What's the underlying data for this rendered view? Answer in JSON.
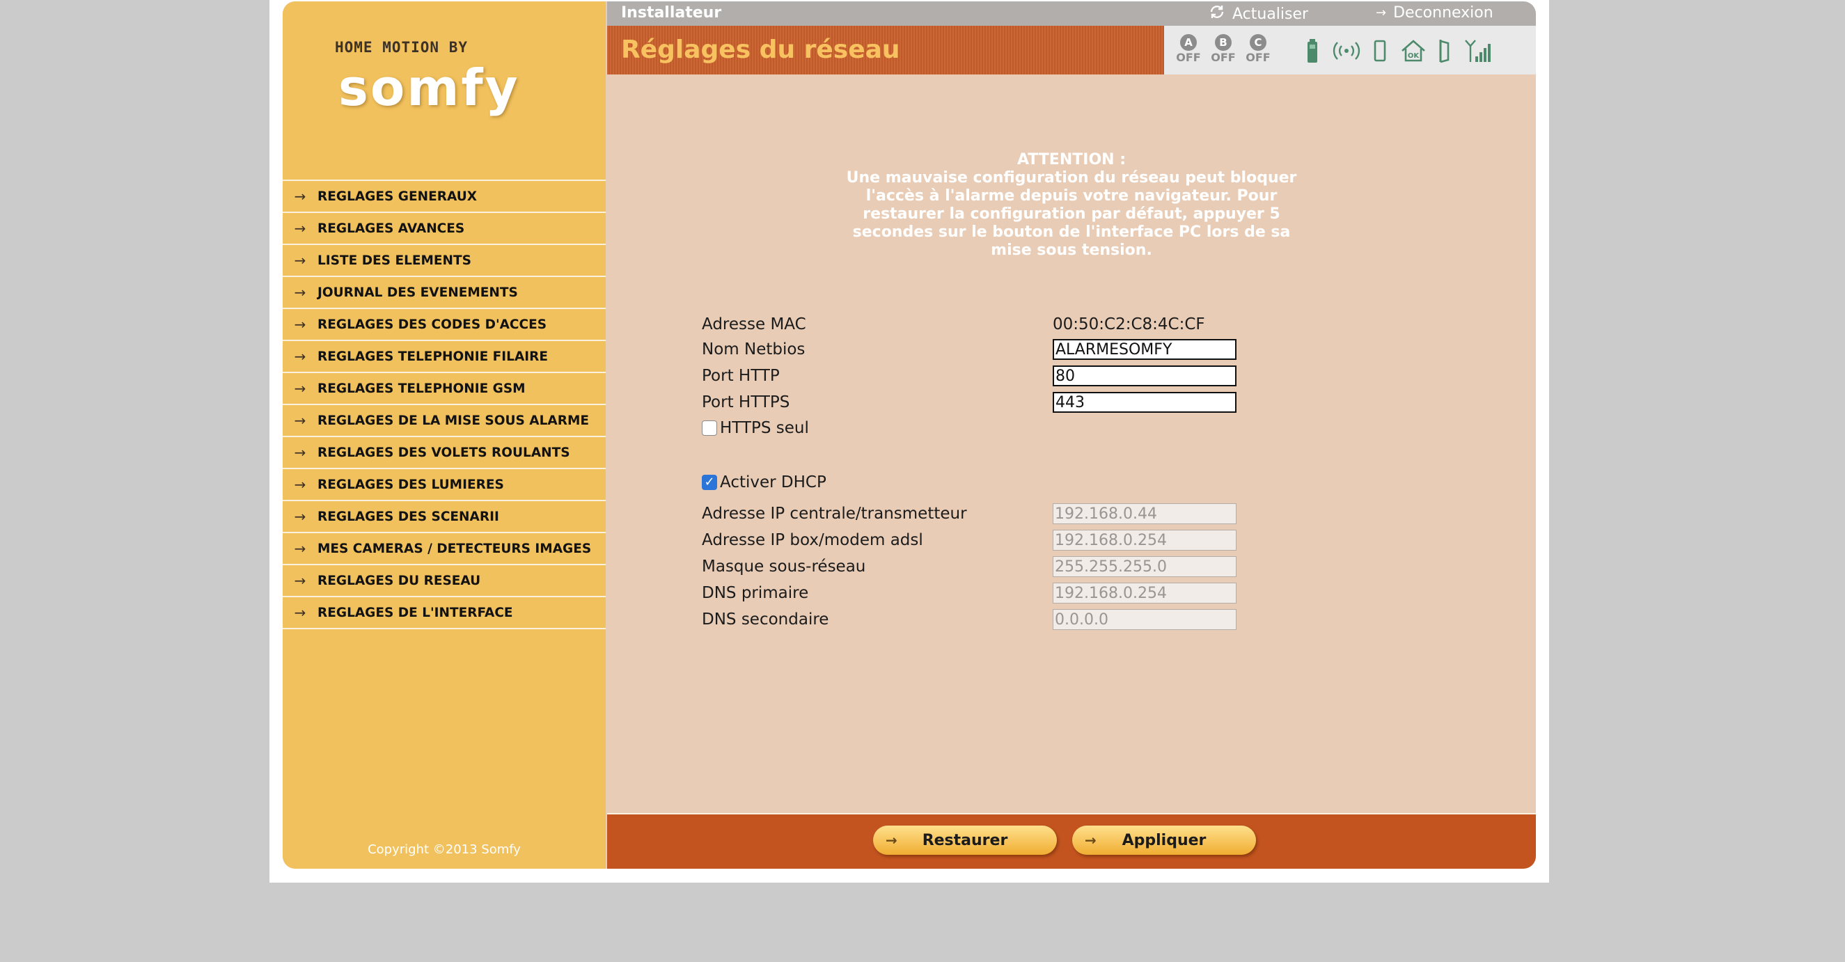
{
  "brand": {
    "tagline": "HOME MOTION BY",
    "name": "somfy"
  },
  "header": {
    "role": "Installateur",
    "refresh_label": "Actualiser",
    "logout_label": "Deconnexion",
    "page_title": "Réglages du réseau"
  },
  "status": {
    "zones": [
      {
        "letter": "A",
        "state": "OFF"
      },
      {
        "letter": "B",
        "state": "OFF"
      },
      {
        "letter": "C",
        "state": "OFF"
      }
    ],
    "icon_color": "#4d8a6c"
  },
  "menu": [
    {
      "label": "REGLAGES GENERAUX"
    },
    {
      "label": "REGLAGES AVANCES"
    },
    {
      "label": "LISTE DES ELEMENTS"
    },
    {
      "label": "JOURNAL DES EVENEMENTS"
    },
    {
      "label": "REGLAGES DES CODES D'ACCES"
    },
    {
      "label": "REGLAGES TELEPHONIE FILAIRE"
    },
    {
      "label": "REGLAGES TELEPHONIE GSM"
    },
    {
      "label": "REGLAGES DE LA MISE SOUS ALARME"
    },
    {
      "label": "REGLAGES DES VOLETS ROULANTS"
    },
    {
      "label": "REGLAGES DES LUMIERES"
    },
    {
      "label": "REGLAGES DES SCENARII"
    },
    {
      "label": "MES CAMERAS / DETECTEURS IMAGES"
    },
    {
      "label": "REGLAGES DU RESEAU"
    },
    {
      "label": "REGLAGES DE L'INTERFACE"
    }
  ],
  "copyright": "Copyright ©2013 Somfy",
  "warning": {
    "title": "ATTENTION :",
    "lines": [
      "Une mauvaise configuration du réseau peut bloquer",
      "l'accès à l'alarme depuis votre navigateur. Pour",
      "restaurer la configuration par défaut, appuyer 5",
      "secondes sur le bouton de l'interface PC lors de sa",
      "mise sous tension."
    ]
  },
  "form": {
    "mac_label": "Adresse MAC",
    "mac_value": "00:50:C2:C8:4C:CF",
    "netbios_label": "Nom Netbios",
    "netbios_value": "ALARMESOMFY",
    "http_label": "Port HTTP",
    "http_value": "80",
    "https_label": "Port HTTPS",
    "https_value": "443",
    "https_only_label": "HTTPS seul",
    "https_only_checked": false,
    "dhcp_label": "Activer DHCP",
    "dhcp_checked": true,
    "ip_central_label": "Adresse IP centrale/transmetteur",
    "ip_central_value": "192.168.0.44",
    "ip_box_label": "Adresse IP box/modem adsl",
    "ip_box_value": "192.168.0.254",
    "mask_label": "Masque sous-réseau",
    "mask_value": "255.255.255.0",
    "dns1_label": "DNS primaire",
    "dns1_value": "192.168.0.254",
    "dns2_label": "DNS secondaire",
    "dns2_value": "0.0.0.0"
  },
  "buttons": {
    "restore": "Restaurer",
    "apply": "Appliquer"
  },
  "icons": {
    "menu_arrow": "arrow-right-icon",
    "refresh": "refresh-icon",
    "logout": "arrow-right-icon",
    "battery": "battery-icon",
    "radio": "radio-signal-icon",
    "tamper": "tamper-icon",
    "home_ok": "home-ok-icon",
    "door": "door-icon",
    "gsm": "gsm-signal-icon"
  }
}
